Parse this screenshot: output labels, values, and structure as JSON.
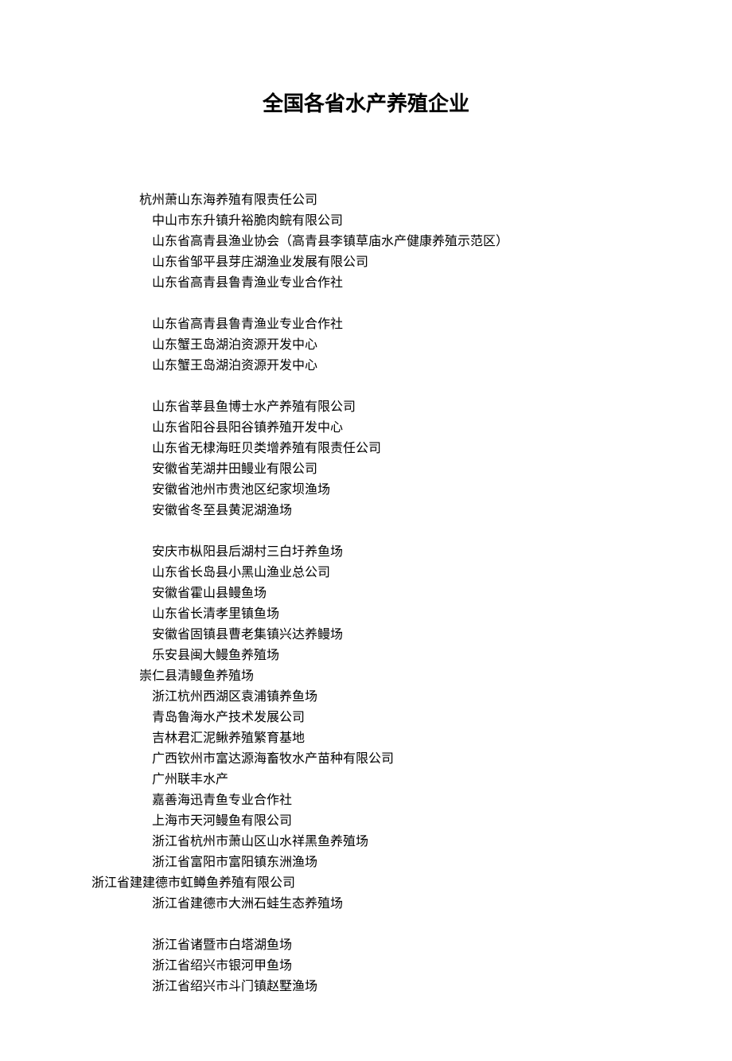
{
  "title": "全国各省水产养殖企业",
  "groups": [
    [
      {
        "text": "杭州萧山东海养殖有限责任公司",
        "indent": 1
      },
      {
        "text": "中山市东升镇升裕脆肉鲩有限公司",
        "indent": 2
      },
      {
        "text": "山东省高青县渔业协会（高青县李镇草庙水产健康养殖示范区）",
        "indent": 2
      },
      {
        "text": "山东省邹平县芽庄湖渔业发展有限公司",
        "indent": 2
      },
      {
        "text": "山东省高青县鲁青渔业专业合作社",
        "indent": 2
      }
    ],
    [
      {
        "text": "山东省高青县鲁青渔业专业合作社",
        "indent": 2
      },
      {
        "text": "山东蟹王岛湖泊资源开发中心",
        "indent": 2
      },
      {
        "text": "山东蟹王岛湖泊资源开发中心",
        "indent": 2
      }
    ],
    [
      {
        "text": "山东省莘县鱼博士水产养殖有限公司",
        "indent": 2
      },
      {
        "text": "山东省阳谷县阳谷镇养殖开发中心",
        "indent": 2
      },
      {
        "text": "山东省无棣海旺贝类增养殖有限责任公司",
        "indent": 2
      },
      {
        "text": "安徽省芜湖井田鳗业有限公司",
        "indent": 2
      },
      {
        "text": "安徽省池州市贵池区纪家坝渔场",
        "indent": 2
      },
      {
        "text": "安徽省冬至县黄泥湖渔场",
        "indent": 2
      }
    ],
    [
      {
        "text": "安庆市枞阳县后湖村三白圩养鱼场",
        "indent": 2
      },
      {
        "text": "山东省长岛县小黑山渔业总公司",
        "indent": 2
      },
      {
        "text": "安徽省霍山县鳗鱼场",
        "indent": 2
      },
      {
        "text": "山东省长清孝里镇鱼场",
        "indent": 2
      },
      {
        "text": "安徽省固镇县曹老集镇兴达养鳗场",
        "indent": 2
      },
      {
        "text": "乐安县闽大鳗鱼养殖场",
        "indent": 2
      },
      {
        "text": "崇仁县清鳗鱼养殖场",
        "indent": 1
      },
      {
        "text": "浙江杭州西湖区袁浦镇养鱼场",
        "indent": 2
      },
      {
        "text": "青岛鲁海水产技术发展公司",
        "indent": 2
      },
      {
        "text": "吉林君汇泥鳅养殖繁育基地",
        "indent": 2
      },
      {
        "text": "广西钦州市富达源海畜牧水产苗种有限公司",
        "indent": 2
      },
      {
        "text": "广州联丰水产",
        "indent": 2
      },
      {
        "text": "嘉善海迅青鱼专业合作社",
        "indent": 2
      },
      {
        "text": "上海市天河鳗鱼有限公司",
        "indent": 2
      },
      {
        "text": "浙江省杭州市萧山区山水祥黑鱼养殖场",
        "indent": 2
      },
      {
        "text": "浙江省富阳市富阳镇东洲渔场",
        "indent": 2
      },
      {
        "text": "浙江省建建德市虹鳟鱼养殖有限公司",
        "indent": 0
      },
      {
        "text": "浙江省建德市大洲石蛙生态养殖场",
        "indent": 2
      }
    ],
    [
      {
        "text": "浙江省诸暨市白塔湖鱼场",
        "indent": 2
      },
      {
        "text": "浙江省绍兴市银河甲鱼场",
        "indent": 2
      },
      {
        "text": "浙江省绍兴市斗门镇赵墅渔场",
        "indent": 2
      }
    ]
  ]
}
